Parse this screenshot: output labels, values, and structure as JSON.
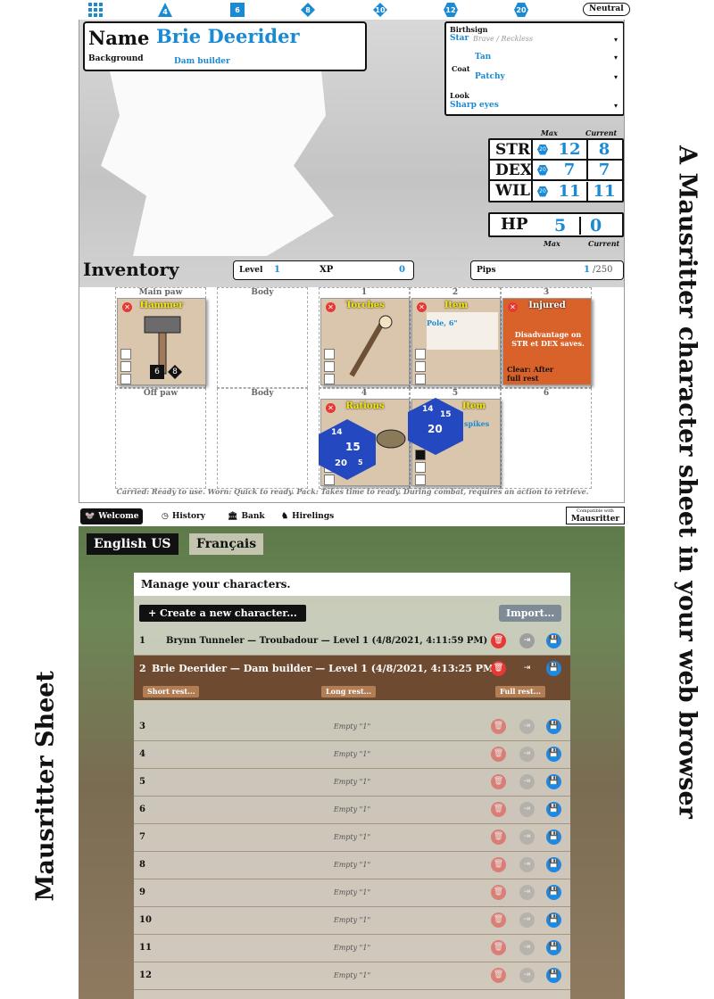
{
  "left_title": "Mausritter Sheet",
  "right_title": "A Mausritter character sheet in your web browser",
  "topbar": {
    "dice": [
      "4",
      "6",
      "8",
      "10",
      "12",
      "20"
    ],
    "disposition": "Neutral"
  },
  "name_box": {
    "label": "Name",
    "value": "Brie Deerider",
    "bg_label": "Background",
    "bg_value": "Dam builder"
  },
  "birth": {
    "birthsign_label": "Birthsign",
    "birthsign": "Star",
    "birthsign_desc": "Brave / Reckless",
    "coat_label": "Coat",
    "coat_color": "Tan",
    "coat_pattern": "Patchy",
    "look_label": "Look",
    "look": "Sharp eyes"
  },
  "stats": {
    "max_label": "Max",
    "current_label": "Current",
    "die": "20",
    "rows": [
      {
        "name": "STR",
        "max": "12",
        "current": "8"
      },
      {
        "name": "DEX",
        "max": "7",
        "current": "7"
      },
      {
        "name": "WIL",
        "max": "11",
        "current": "11"
      }
    ]
  },
  "hp": {
    "label": "HP",
    "max": "5",
    "current": "0",
    "max_label": "Max",
    "current_label": "Current"
  },
  "inventory": {
    "title": "Inventory",
    "level_label": "Level",
    "level": "1",
    "xp_label": "XP",
    "xp": "0",
    "pips_label": "Pips",
    "pips": "1",
    "pips_max": "/250",
    "slots": {
      "main": "Main paw",
      "off": "Off paw",
      "body": "Body",
      "p1": "1",
      "p2": "2",
      "p3": "3",
      "p4": "4",
      "p5": "5",
      "p6": "6"
    },
    "cards": {
      "hammer": "Hammer",
      "hammer_d1": "6",
      "hammer_d2": "8",
      "torches": "Torches",
      "item": "Item",
      "item_desc": "Pole, 6\"",
      "injured": "Injured",
      "injured_desc": "Disadvantage on STR et DEX saves.",
      "injured_clear": "Clear: After full rest",
      "rations": "Rations",
      "item2": "Item",
      "item2_desc": "spikes"
    },
    "dice_a": [
      "14",
      "15",
      "20",
      "5"
    ],
    "dice_b": [
      "14",
      "15",
      "20"
    ],
    "usage": "Carried: Ready to use.    Worn: Quick to ready.    Pack: Takes time to ready. During combat, requires an action to retrieve."
  },
  "tabs": [
    {
      "label": "Welcome"
    },
    {
      "label": "History"
    },
    {
      "label": "Bank"
    },
    {
      "label": "Hirelings"
    }
  ],
  "compat": {
    "small": "Compatible with",
    "big": "Mausritter"
  },
  "langs": [
    "English US",
    "Français"
  ],
  "manage": {
    "title": "Manage your characters.",
    "create": "+ Create a new character...",
    "import": "Import...",
    "row1": {
      "n": "1",
      "text": "Brynn Tunneler — Troubadour — Level 1 (4/8/2021, 4:11:59 PM)"
    },
    "row2": {
      "n": "2",
      "text": "Brie Deerider — Dam builder — Level 1 (4/8/2021, 4:13:25 PM)",
      "short": "Short rest...",
      "long": "Long rest...",
      "full": "Full rest..."
    },
    "empty_label": "Empty \"1\"",
    "empty_rows": [
      "3",
      "4",
      "5",
      "6",
      "7",
      "8",
      "9",
      "10",
      "11",
      "12"
    ]
  }
}
